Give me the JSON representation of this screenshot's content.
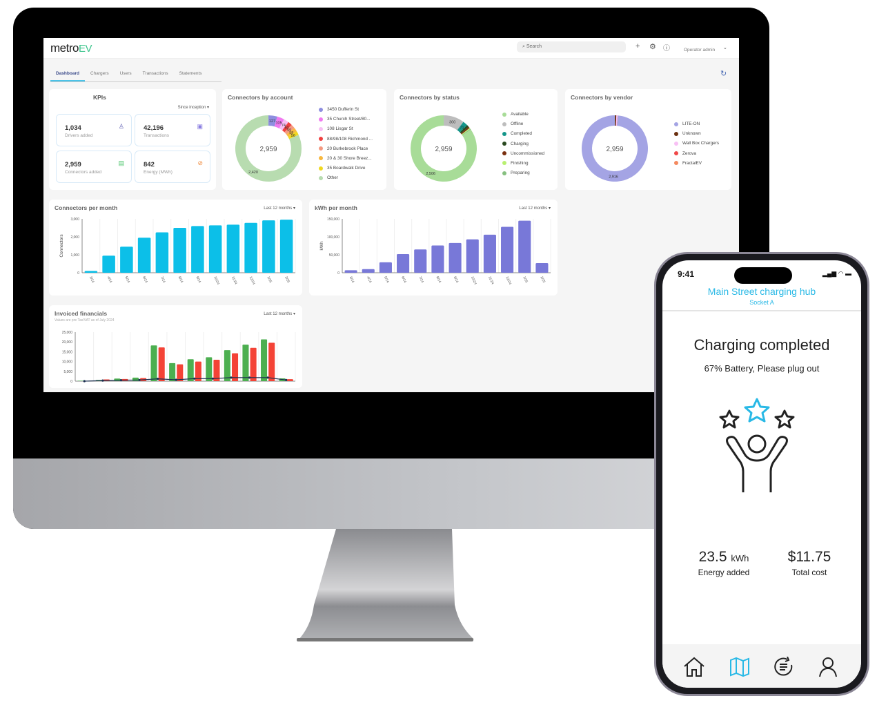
{
  "app": {
    "logo_main": "metro",
    "logo_accent": "EV",
    "search_placeholder": "Search",
    "user_label": "Operator admin",
    "icons": [
      "plus-icon",
      "gear-icon",
      "help-icon",
      "chevron-down-icon",
      "refresh-icon",
      "search-icon"
    ]
  },
  "tabs": [
    {
      "label": "Dashboard",
      "active": true
    },
    {
      "label": "Chargers",
      "active": false
    },
    {
      "label": "Users",
      "active": false
    },
    {
      "label": "Transactions",
      "active": false
    },
    {
      "label": "Statements",
      "active": false
    }
  ],
  "kpis": {
    "title": "KPIs",
    "range": "Since inception",
    "items": [
      {
        "value": "1,034",
        "label": "Drivers added",
        "icon": "user-icon",
        "color": "#5a5ab0"
      },
      {
        "value": "42,196",
        "label": "Transactions",
        "icon": "receipt-icon",
        "color": "#8a7ee0"
      },
      {
        "value": "2,959",
        "label": "Connectors added",
        "icon": "plug-icon",
        "color": "#4cc46c"
      },
      {
        "value": "842",
        "label": "Energy (MWh)",
        "icon": "bolt-icon",
        "color": "#f08a3c"
      }
    ]
  },
  "chart_data": [
    {
      "type": "pie",
      "title": "Connectors by account",
      "total_label": "2,959",
      "labels": [
        "3450 Dufferin St",
        "35 Church Street/80...",
        "108 Lisgar St",
        "88/98/108 Richmond ...",
        "20 Burkebrook Place",
        "20 & 30 Shore Breez...",
        "35 Boardwalk Drive",
        "Other"
      ],
      "values": [
        127,
        105,
        74,
        60,
        59,
        58,
        56,
        2420
      ],
      "colors": [
        "#8e8ee0",
        "#f07af0",
        "#f8c0f4",
        "#f04040",
        "#f49a80",
        "#f8b840",
        "#f0d820",
        "#b8dcb0"
      ]
    },
    {
      "type": "pie",
      "title": "Connectors by status",
      "total_label": "2,959",
      "labels": [
        "Available",
        "Offline",
        "Completed",
        "Charging",
        "Uncommissioned",
        "Finishing",
        "Preparing"
      ],
      "values": [
        2506,
        300,
        71,
        32,
        22,
        15,
        13
      ],
      "colors": [
        "#a8dc98",
        "#bdbdbd",
        "#14968a",
        "#2a4a20",
        "#7a3010",
        "#b8f070",
        "#86c080"
      ]
    },
    {
      "type": "pie",
      "title": "Connectors by vendor",
      "total_label": "2,959",
      "labels": [
        "LITE-ON",
        "Unknown",
        "Wall Box Chargers",
        "Zerova",
        "FractalEV"
      ],
      "values": [
        2916,
        22,
        18,
        2,
        1
      ],
      "colors": [
        "#a4a4e4",
        "#6a3010",
        "#f8c0f4",
        "#f04848",
        "#f48a60"
      ]
    },
    {
      "type": "bar",
      "title": "Connectors per month",
      "range": "Last 12 months",
      "categories": [
        "3/24",
        "4/24",
        "5/24",
        "6/24",
        "7/24",
        "8/24",
        "9/24",
        "10/24",
        "11/24",
        "12/24",
        "1/25",
        "2/25"
      ],
      "values": [
        100,
        950,
        1450,
        1950,
        2250,
        2500,
        2600,
        2640,
        2680,
        2780,
        2920,
        2959
      ],
      "ylabel": "Connectors",
      "ylim": [
        0,
        3000
      ],
      "yticks": [
        0,
        1000,
        2000,
        3000
      ],
      "color": "#0cbfe8",
      "grid": true
    },
    {
      "type": "bar",
      "title": "kWh per month",
      "range": "Last 12 months",
      "categories": [
        "3/24",
        "4/24",
        "5/24",
        "6/24",
        "7/24",
        "8/24",
        "9/24",
        "10/24",
        "11/24",
        "12/24",
        "1/25",
        "2/25"
      ],
      "values": [
        7000,
        10000,
        29000,
        52000,
        65000,
        76000,
        83000,
        93000,
        106000,
        128000,
        145000,
        27000
      ],
      "ylabel": "kWh",
      "ylim": [
        0,
        150000
      ],
      "yticks": [
        0,
        50000,
        100000,
        150000
      ],
      "color": "#7878d8",
      "grid": true
    },
    {
      "type": "bar",
      "title": "Invoiced financials",
      "subtitle": "Values are pre Tax/VAT as of July 2024",
      "range": "Last 12 months",
      "ylim": [
        0,
        25000
      ],
      "yticks": [
        0,
        5000,
        10000,
        15000,
        20000,
        25000
      ],
      "series": [
        {
          "name": "green",
          "color": "#4caf50",
          "values": [
            200,
            600,
            1300,
            1800,
            18200,
            9200,
            11200,
            12200,
            15800,
            18600,
            21300,
            1400
          ]
        },
        {
          "name": "red",
          "color": "#f44336",
          "values": [
            100,
            900,
            1100,
            1600,
            17200,
            8600,
            10000,
            10900,
            14200,
            17000,
            19600,
            1000
          ]
        },
        {
          "name": "line",
          "color": "#1a2f50",
          "type": "line",
          "values": [
            0,
            300,
            500,
            600,
            1200,
            700,
            1300,
            1300,
            1800,
            1800,
            1800,
            600
          ]
        }
      ]
    }
  ],
  "phone": {
    "time": "9:41",
    "hub": "Main Street charging hub",
    "socket": "Socket A",
    "status": "Charging completed",
    "battery_msg": "67% Battery, Please plug out",
    "energy_value": "23.5",
    "energy_unit": "kWh",
    "energy_label": "Energy added",
    "cost_value": "$11.75",
    "cost_label": "Total cost",
    "nav": [
      "home-icon",
      "map-icon",
      "history-icon",
      "profile-icon"
    ],
    "active_nav": "map-icon",
    "accent": "#29b9e6"
  }
}
